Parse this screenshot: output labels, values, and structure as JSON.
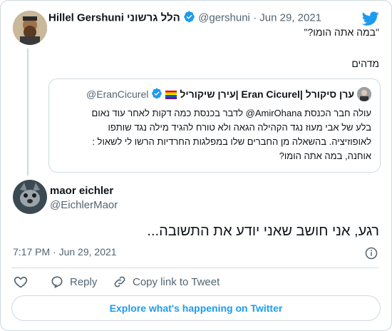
{
  "parent_tweet": {
    "display_name": "Hillel Gershuni הלל גרשוני",
    "handle": "@gershuni",
    "separator": "·",
    "date": "Jun 29, 2021",
    "text_line1": "\"במה אתה הומו?\"",
    "text_line2": "מדהים"
  },
  "quoted_tweet": {
    "display_name": "עירן שיקוריל| Eran Cicurel| ערן סיקורל",
    "handle": "@EranCicurel",
    "lines": [
      "עולה חבר הכנסת AmirOhana@ לדבר בכנסת כמה דקות לאחר עוד נאום",
      "בלע של אבי מעוז נגד הקהילה הגאה ולא טורח להגיד מילה נגד שותפו",
      "לאופוזיציה. בהשאלה מן החברים שלו במפלגות החרדיות הרשו לי לשאול :",
      "אוחנה, במה אתה הומו?"
    ]
  },
  "main_tweet": {
    "display_name": "maor eichler",
    "handle": "@EichlerMaor",
    "text": "רגע, אני חושב שאני יודע את התשובה...",
    "time": "7:17 PM",
    "separator": "·",
    "date": "Jun 29, 2021"
  },
  "actions": {
    "reply": "Reply",
    "copy_link": "Copy link to Tweet"
  },
  "explore_label": "Explore what's happening on Twitter",
  "colors": {
    "accent": "#1d9bf0",
    "border": "#cfd9de",
    "muted": "#536471",
    "text": "#0f1419"
  }
}
